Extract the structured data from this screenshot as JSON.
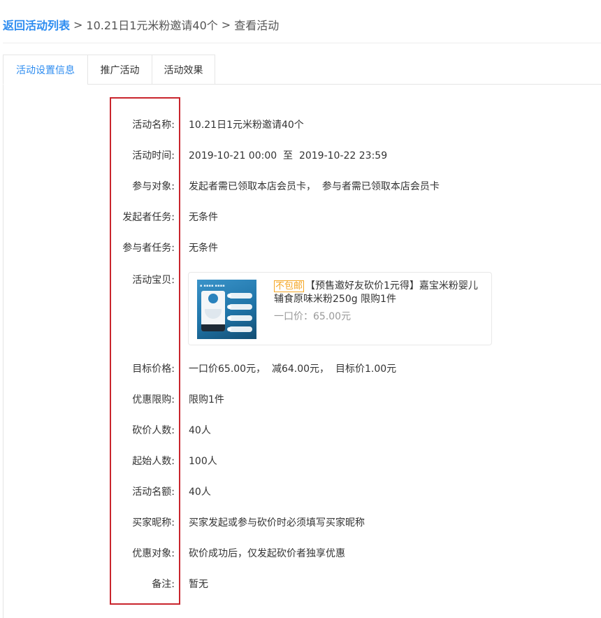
{
  "breadcrumb": {
    "back_label": "返回活动列表",
    "separator": ">",
    "activity_name": "10.21日1元米粉邀请40个",
    "current_page": "查看活动"
  },
  "tabs": [
    {
      "label": "活动设置信息",
      "active": true
    },
    {
      "label": "推广活动",
      "active": false
    },
    {
      "label": "活动效果",
      "active": false
    }
  ],
  "fields": [
    {
      "key": "name",
      "label": "活动名称:",
      "value": "10.21日1元米粉邀请40个"
    },
    {
      "key": "time",
      "label": "活动时间:",
      "value": "2019-10-21 00:00  至  2019-10-22 23:59"
    },
    {
      "key": "audience",
      "label": "参与对象:",
      "value": "发起者需已领取本店会员卡，  参与者需已领取本店会员卡"
    },
    {
      "key": "initiator-task",
      "label": "发起者任务:",
      "value": "无条件"
    },
    {
      "key": "participant-task",
      "label": "参与者任务:",
      "value": "无条件"
    },
    {
      "key": "product",
      "label": "活动宝贝:",
      "value": ""
    },
    {
      "key": "target-price",
      "label": "目标价格:",
      "value": "一口价65.00元，  减64.00元，  目标价1.00元"
    },
    {
      "key": "purchase-limit",
      "label": "优惠限购:",
      "value": "限购1件"
    },
    {
      "key": "bargain-count",
      "label": "砍价人数:",
      "value": "40人"
    },
    {
      "key": "start-count",
      "label": "起始人数:",
      "value": "100人"
    },
    {
      "key": "quota",
      "label": "活动名额:",
      "value": "40人"
    },
    {
      "key": "nickname",
      "label": "买家昵称:",
      "value": "买家发起或参与砍价时必须填写买家昵称"
    },
    {
      "key": "discount-target",
      "label": "优惠对象:",
      "value": "砍价成功后，仅发起砍价者独享优惠"
    },
    {
      "key": "remark",
      "label": "备注:",
      "value": "暂无"
    }
  ],
  "product": {
    "tag": "不包邮",
    "title": "【预售邀好友砍价1元得】嘉宝米粉婴儿辅食原味米粉250g 限购1件",
    "price_label": "一口价：",
    "price": "65.00元",
    "image_icon": "product-image-icon"
  },
  "colors": {
    "accent": "#2d8cf0",
    "highlight_box": "#c9252d",
    "tag": "#f5a623"
  }
}
